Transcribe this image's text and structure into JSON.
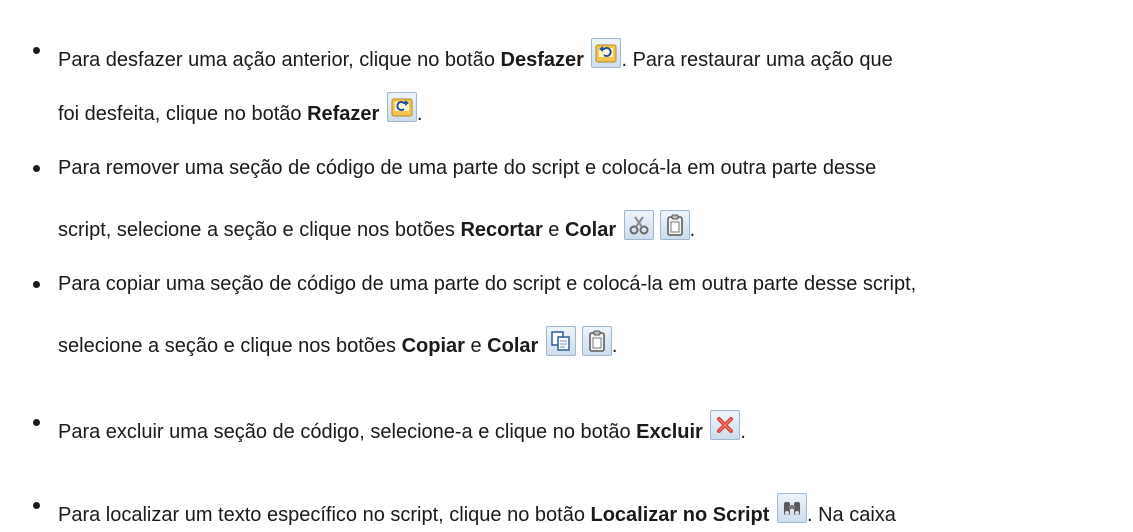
{
  "items": [
    {
      "line1": {
        "before": "Para desfazer uma ação anterior, clique no botão ",
        "bold": "Desfazer",
        "after": ". Para restaurar uma ação que"
      },
      "line2": {
        "before": "foi desfeita, clique no botão ",
        "bold": "Refazer",
        "after": "."
      },
      "icons": [
        "undo-icon",
        "redo-icon"
      ]
    },
    {
      "line1": {
        "text": "Para remover uma seção de código de uma parte do script e colocá-la em outra parte desse"
      },
      "line2": {
        "before": "script, selecione a seção e clique nos botões ",
        "bold1": "Recortar",
        "mid": " e ",
        "bold2": "Colar",
        "after": "."
      },
      "icons": [
        "scissors-icon",
        "clipboard-icon"
      ]
    },
    {
      "line1": {
        "text": "Para copiar uma seção de código de uma parte do script e colocá-la em outra parte desse script,"
      },
      "line2": {
        "before": "selecione a seção e clique nos botões ",
        "bold1": "Copiar",
        "mid": " e ",
        "bold2": "Colar",
        "after": "."
      },
      "icons": [
        "copy-icon",
        "clipboard-icon"
      ]
    },
    {
      "line1": {
        "before": "Para excluir uma seção de código, selecione-a e clique no botão ",
        "bold": "Excluir",
        "after": "."
      },
      "icons": [
        "delete-x-icon"
      ]
    },
    {
      "line1": {
        "before": "Para localizar um texto específico no script, clique no botão ",
        "bold": "Localizar no Script",
        "after": ". Na caixa"
      },
      "icons": [
        "binoculars-icon"
      ]
    }
  ]
}
